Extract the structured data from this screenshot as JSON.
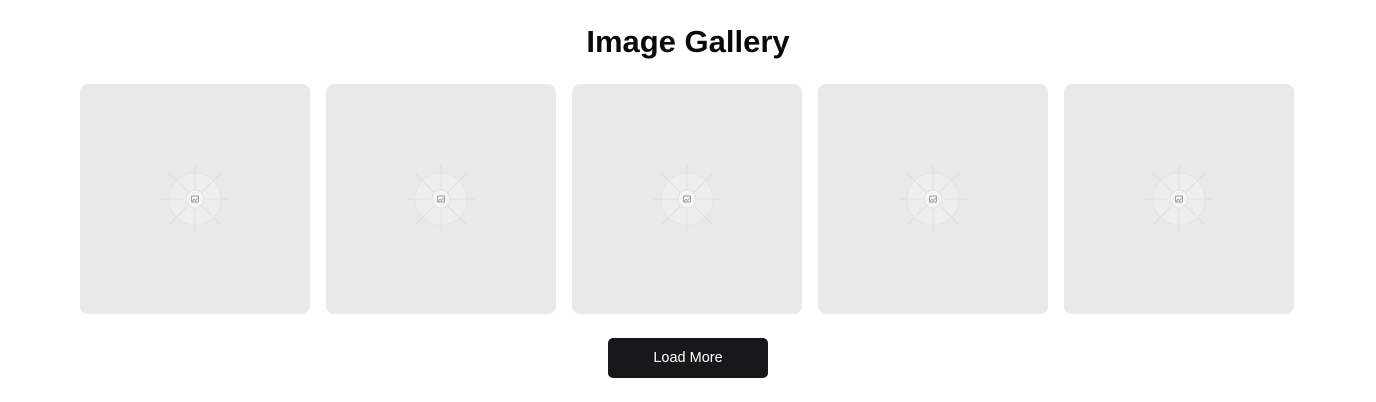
{
  "gallery": {
    "title": "Image Gallery",
    "items": [
      {
        "icon": "image-placeholder-icon"
      },
      {
        "icon": "image-placeholder-icon"
      },
      {
        "icon": "image-placeholder-icon"
      },
      {
        "icon": "image-placeholder-icon"
      },
      {
        "icon": "image-placeholder-icon"
      }
    ],
    "load_more_label": "Load More"
  },
  "colors": {
    "card_background": "#e9e9e9",
    "button_background": "#18181b",
    "button_text": "#ffffff",
    "title_text": "#0a0a0a"
  }
}
